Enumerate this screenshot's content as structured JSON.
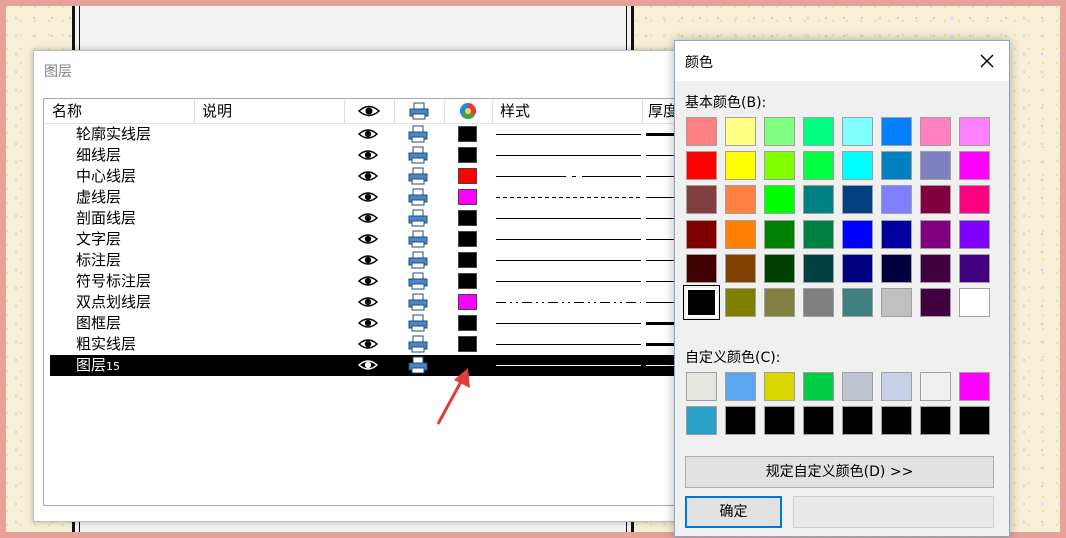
{
  "layer_dialog": {
    "title": "图层",
    "columns": {
      "name": "名称",
      "description": "说明",
      "style": "样式",
      "thickness": "厚度"
    },
    "rows": [
      {
        "name": "轮廓实线层",
        "color": "#000000",
        "line": "solid",
        "weight": "thick"
      },
      {
        "name": "细线层",
        "color": "#000000",
        "line": "solid",
        "weight": "thin"
      },
      {
        "name": "中心线层",
        "color": "#ff0000",
        "line": "center",
        "weight": "thin"
      },
      {
        "name": "虚线层",
        "color": "#ff00ff",
        "line": "dashed",
        "weight": "thin"
      },
      {
        "name": "剖面线层",
        "color": "#000000",
        "line": "solid",
        "weight": "thin"
      },
      {
        "name": "文字层",
        "color": "#000000",
        "line": "solid",
        "weight": "thin"
      },
      {
        "name": "标注层",
        "color": "#000000",
        "line": "solid",
        "weight": "thin"
      },
      {
        "name": "符号标注层",
        "color": "#000000",
        "line": "solid",
        "weight": "thin"
      },
      {
        "name": "双点划线层",
        "color": "#ff00ff",
        "line": "dashdotdot",
        "weight": "thin"
      },
      {
        "name": "图框层",
        "color": "#000000",
        "line": "solid",
        "weight": "thick"
      },
      {
        "name": "粗实线层",
        "color": "#000000",
        "line": "solid",
        "weight": "thick"
      }
    ],
    "selected_row": {
      "name": "图层",
      "suffix": "15"
    }
  },
  "color_dialog": {
    "title": "颜色",
    "basic_label": "基本颜色(B):",
    "basic_colors": [
      "#ff8080",
      "#ffff80",
      "#80ff80",
      "#00ff80",
      "#80ffff",
      "#0080ff",
      "#ff80c0",
      "#ff80ff",
      "#ff0000",
      "#ffff00",
      "#80ff00",
      "#00ff40",
      "#00ffff",
      "#0080c0",
      "#8080c0",
      "#ff00ff",
      "#804040",
      "#ff8040",
      "#00ff00",
      "#008080",
      "#004080",
      "#8080ff",
      "#800040",
      "#ff0080",
      "#800000",
      "#ff8000",
      "#008000",
      "#008040",
      "#0000ff",
      "#0000a0",
      "#800080",
      "#8000ff",
      "#400000",
      "#804000",
      "#004000",
      "#004040",
      "#000080",
      "#000040",
      "#400040",
      "#400080",
      "#000000",
      "#808000",
      "#808040",
      "#808080",
      "#408080",
      "#c0c0c0",
      "#400040",
      "#ffffff"
    ],
    "selected_basic_index": 40,
    "custom_label": "自定义颜色(C):",
    "custom_colors": [
      "#e6e6e0",
      "#5aa6f0",
      "#d8d800",
      "#00cc44",
      "#c0c4d0",
      "#c8d0e8",
      "#f0f0f0",
      "#ff00ff",
      "#2aa0c8",
      "#000000",
      "#000000",
      "#000000",
      "#000000",
      "#000000",
      "#000000",
      "#000000"
    ],
    "define_custom_label": "规定自定义颜色(D) >>",
    "ok_label": "确定"
  }
}
